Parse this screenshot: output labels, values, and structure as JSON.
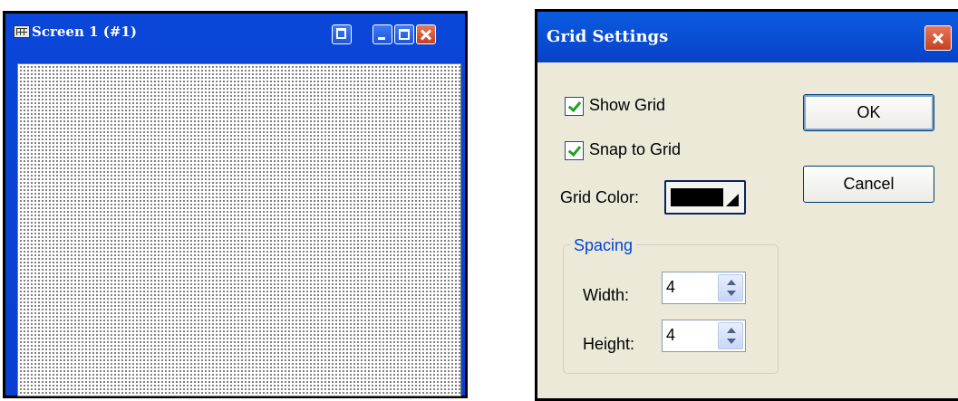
{
  "screen_window": {
    "title": "Screen 1 (#1)",
    "icons": [
      "grid-app-icon",
      "restore-icon",
      "minimize-icon",
      "maximize-icon",
      "close-icon"
    ]
  },
  "dialog": {
    "title": "Grid Settings",
    "show_grid": {
      "label": "Show Grid",
      "checked": true
    },
    "snap_to_grid": {
      "label": "Snap to Grid",
      "checked": true
    },
    "grid_color": {
      "label": "Grid Color:",
      "value": "#000000"
    },
    "ok_label": "OK",
    "cancel_label": "Cancel",
    "spacing": {
      "group_label": "Spacing",
      "width_label": "Width:",
      "width_value": "4",
      "height_label": "Height:",
      "height_value": "4"
    }
  },
  "colors": {
    "titlebar_blue": "#0a46d8",
    "dialog_bg": "#ece9d8",
    "close_red": "#c5401f",
    "check_green": "#21a121",
    "group_label_blue": "#0046d5"
  }
}
